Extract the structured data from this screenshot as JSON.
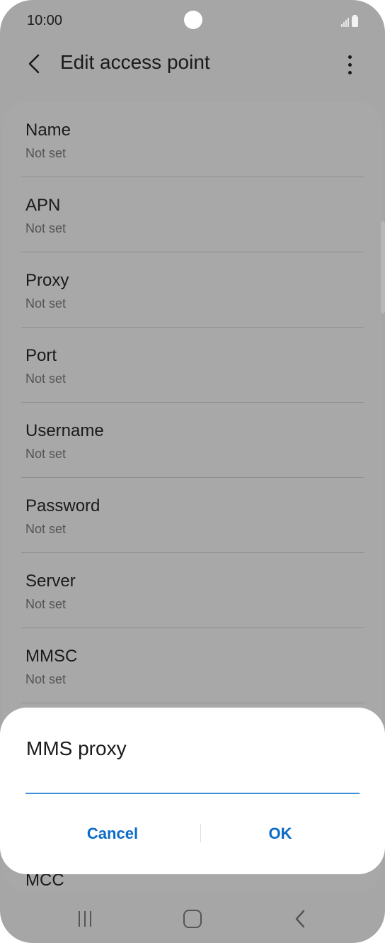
{
  "status_bar": {
    "time": "10:00",
    "icons": [
      "signal-icon",
      "battery-icon"
    ]
  },
  "toolbar": {
    "title": "Edit access point",
    "back_icon": "chevron-left-icon",
    "more_icon": "more-vertical-icon"
  },
  "list": {
    "items": [
      {
        "title": "Name",
        "value": "Not set"
      },
      {
        "title": "APN",
        "value": "Not set"
      },
      {
        "title": "Proxy",
        "value": "Not set"
      },
      {
        "title": "Port",
        "value": "Not set"
      },
      {
        "title": "Username",
        "value": "Not set"
      },
      {
        "title": "Password",
        "value": "Not set"
      },
      {
        "title": "Server",
        "value": "Not set"
      },
      {
        "title": "MMSC",
        "value": "Not set"
      }
    ],
    "partial_item": "MCC"
  },
  "dialog": {
    "title": "MMS proxy",
    "input_value": "",
    "cancel_label": "Cancel",
    "ok_label": "OK"
  },
  "nav_bar": {
    "icons": [
      "recent-apps-icon",
      "home-icon",
      "back-icon"
    ]
  },
  "colors": {
    "accent": "#0b6bc6",
    "input_underline": "#3e8fd8",
    "scrim_background": "#a6a6a6",
    "dialog_background": "#ffffff"
  }
}
